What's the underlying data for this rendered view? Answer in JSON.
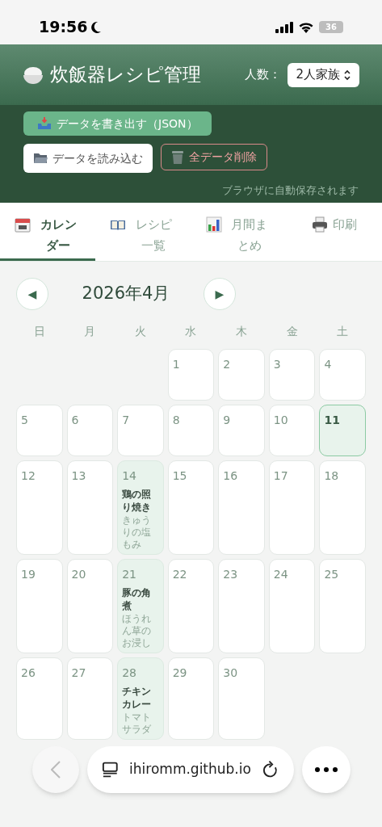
{
  "status_bar": {
    "time": "19:56",
    "battery": "36"
  },
  "header": {
    "title": "炊飯器レシピ管理",
    "people_label": "人数：",
    "people_value": "2人家族"
  },
  "actions": {
    "export": "データを書き出す（JSON）",
    "import": "データを読み込む",
    "delete": "全データ削除",
    "note": "ブラウザに自動保存されます"
  },
  "tabs": [
    {
      "kind": "calendar",
      "label": "カレンダー",
      "selected": true
    },
    {
      "kind": "book",
      "label": "レシピ一覧",
      "selected": false
    },
    {
      "kind": "chart",
      "label": "月間まとめ",
      "selected": false
    },
    {
      "kind": "printer",
      "label": "印刷",
      "selected": false
    }
  ],
  "month_nav": {
    "prev": "◀",
    "title": "2026年4月",
    "next": "▶"
  },
  "weekdays": [
    "日",
    "月",
    "火",
    "水",
    "木",
    "金",
    "土"
  ],
  "weeks": [
    [
      {
        "kind": "blank"
      },
      {
        "kind": "blank"
      },
      {
        "kind": "blank"
      },
      {
        "kind": "day",
        "day": "1",
        "today": false
      },
      {
        "kind": "day",
        "day": "2",
        "today": false
      },
      {
        "kind": "day",
        "day": "3",
        "today": false
      },
      {
        "kind": "day",
        "day": "4",
        "today": false
      }
    ],
    [
      {
        "kind": "day",
        "day": "5",
        "today": false
      },
      {
        "kind": "day",
        "day": "6",
        "today": false
      },
      {
        "kind": "day",
        "day": "7",
        "today": false
      },
      {
        "kind": "day",
        "day": "8",
        "today": false
      },
      {
        "kind": "day",
        "day": "9",
        "today": false
      },
      {
        "kind": "day",
        "day": "10",
        "today": false
      },
      {
        "kind": "day",
        "day": "11",
        "today": true
      }
    ],
    [
      {
        "kind": "day",
        "day": "12",
        "today": false
      },
      {
        "kind": "day",
        "day": "13",
        "today": false
      },
      {
        "kind": "day",
        "day": "14",
        "today": false,
        "meal": "鶏の照り焼き",
        "side": "きゅうりの塩もみ"
      },
      {
        "kind": "day",
        "day": "15",
        "today": false
      },
      {
        "kind": "day",
        "day": "16",
        "today": false
      },
      {
        "kind": "day",
        "day": "17",
        "today": false
      },
      {
        "kind": "day",
        "day": "18",
        "today": false
      }
    ],
    [
      {
        "kind": "day",
        "day": "19",
        "today": false
      },
      {
        "kind": "day",
        "day": "20",
        "today": false
      },
      {
        "kind": "day",
        "day": "21",
        "today": false,
        "meal": "豚の角煮",
        "side": "ほうれん草のお浸し"
      },
      {
        "kind": "day",
        "day": "22",
        "today": false
      },
      {
        "kind": "day",
        "day": "23",
        "today": false
      },
      {
        "kind": "day",
        "day": "24",
        "today": false
      },
      {
        "kind": "day",
        "day": "25",
        "today": false
      }
    ],
    [
      {
        "kind": "day",
        "day": "26",
        "today": false
      },
      {
        "kind": "day",
        "day": "27",
        "today": false
      },
      {
        "kind": "day",
        "day": "28",
        "today": false,
        "meal": "チキンカレー",
        "side": "トマトサラダ"
      },
      {
        "kind": "day",
        "day": "29",
        "today": false
      },
      {
        "kind": "day",
        "day": "30",
        "today": false
      },
      {
        "kind": "blank"
      },
      {
        "kind": "blank"
      }
    ]
  ],
  "browser_bar": {
    "url": "ihiromm.github.io"
  }
}
